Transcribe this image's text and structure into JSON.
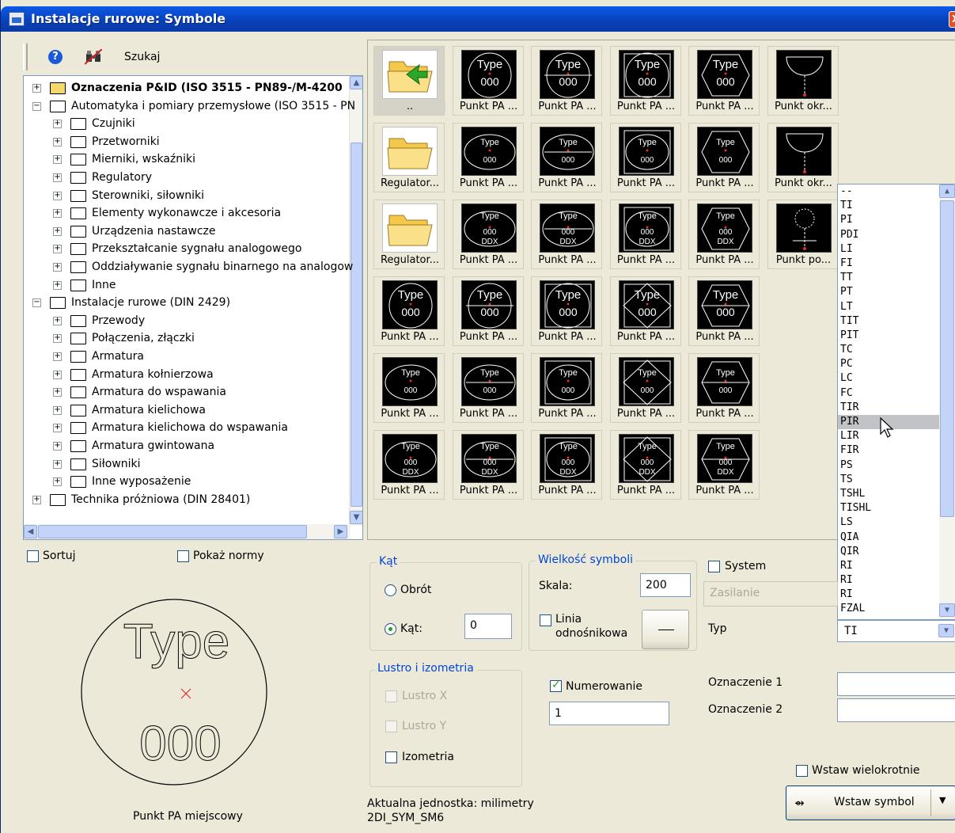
{
  "window": {
    "title": "Instalacje rurowe: Symbole",
    "close": "X"
  },
  "toolbar": {
    "search_label": "Szukaj"
  },
  "tree": {
    "items": [
      {
        "label": "Oznaczenia P&ID (ISO 3515 - PN89-/M-4200",
        "level": 0,
        "expanded": false,
        "bold": true,
        "open": true
      },
      {
        "label": "Automatyka i pomiary przemysłowe (ISO 3515 - PN",
        "level": 0,
        "expanded": true
      },
      {
        "label": "Czujniki",
        "level": 1
      },
      {
        "label": "Przetworniki",
        "level": 1
      },
      {
        "label": "Mierniki, wskaźniki",
        "level": 1
      },
      {
        "label": "Regulatory",
        "level": 1
      },
      {
        "label": "Sterowniki, siłowniki",
        "level": 1
      },
      {
        "label": "Elementy wykonawcze i akcesoria",
        "level": 1
      },
      {
        "label": "Urządzenia nastawcze",
        "level": 1
      },
      {
        "label": "Przekształcanie sygnału analogowego",
        "level": 1
      },
      {
        "label": "Oddziaływanie sygnału binarnego na analogow",
        "level": 1
      },
      {
        "label": "Inne",
        "level": 1
      },
      {
        "label": "Instalacje rurowe (DIN 2429)",
        "level": 0,
        "expanded": true
      },
      {
        "label": "Przewody",
        "level": 1
      },
      {
        "label": "Połączenia, złączki",
        "level": 1
      },
      {
        "label": "Armatura",
        "level": 1
      },
      {
        "label": "Armatura kołnierzowa",
        "level": 1
      },
      {
        "label": "Armatura do wspawania",
        "level": 1
      },
      {
        "label": "Armatura kielichowa",
        "level": 1
      },
      {
        "label": "Armatura kielichowa do wspawania",
        "level": 1
      },
      {
        "label": "Armatura gwintowana",
        "level": 1
      },
      {
        "label": "Siłowniki",
        "level": 1
      },
      {
        "label": "Inne wyposażenie",
        "level": 1
      },
      {
        "label": "Technika próżniowa (DIN 28401)",
        "level": 0,
        "expanded": false
      }
    ]
  },
  "symbols": {
    "rows": [
      [
        "..",
        "Punkt PA ...",
        "Punkt PA ...",
        "Punkt PA ...",
        "Punkt PA ...",
        "Punkt okr..."
      ],
      [
        "Regulator...",
        "Punkt PA ...",
        "Punkt PA ...",
        "Punkt PA ...",
        "Punkt PA ...",
        "Punkt okr..."
      ],
      [
        "Regulator...",
        "Punkt PA ...",
        "Punkt PA ...",
        "Punkt PA ...",
        "Punkt PA ...",
        "Punkt po..."
      ],
      [
        "Punkt PA ...",
        "Punkt PA ...",
        "Punkt PA ...",
        "Punkt PA ...",
        "Punkt PA ..."
      ],
      [
        "Punkt PA ...",
        "Punkt PA ...",
        "Punkt PA ...",
        "Punkt PA ...",
        "Punkt PA ..."
      ],
      [
        "Punkt PA ...",
        "Punkt PA ...",
        "Punkt PA ...",
        "Punkt PA ...",
        "Punkt PA ..."
      ]
    ],
    "glyph_type": "Type",
    "glyph_num": "000",
    "glyph_num2": "DDX"
  },
  "dropdown": {
    "items": [
      "--",
      "TI",
      "PI",
      "PDI",
      "LI",
      "FI",
      "TT",
      "PT",
      "LT",
      "TIT",
      "PIT",
      "TC",
      "PC",
      "LC",
      "FC",
      "TIR",
      "PIR",
      "LIR",
      "FIR",
      "PS",
      "TS",
      "TSHL",
      "TISHL",
      "LS",
      "QIA",
      "QIR",
      "RI",
      "RI",
      "RI",
      "FZAL"
    ],
    "highlighted": "PIR",
    "selected": "TI"
  },
  "options": {
    "sort": "Sortuj",
    "show_norms": "Pokaż normy"
  },
  "preview": {
    "type": "Type",
    "num": "000",
    "caption": "Punkt PA miejscowy"
  },
  "angle": {
    "title": "Kąt",
    "rotation": "Obrót",
    "angle": "Kąt:",
    "angle_value": "0"
  },
  "size": {
    "title": "Wielkość symboli",
    "scale": "Skala:",
    "scale_value": "200",
    "leader": "Linia",
    "leader2": "odnośnikowa"
  },
  "mirror": {
    "title": "Lustro i izometria",
    "mirror_x": "Lustro X",
    "mirror_y": "Lustro Y",
    "iso": "Izometria"
  },
  "system": {
    "label": "System",
    "placeholder": "Zasilanie",
    "type": "Typ"
  },
  "numbering": {
    "label": "Numerowanie",
    "value": "1"
  },
  "labels": {
    "l1": "Oznaczenie 1",
    "l2": "Oznaczenie 2"
  },
  "footer": {
    "unit": "Aktualna jednostka: milimetry",
    "code": "2DI_SYM_SM6"
  },
  "insert": {
    "multi": "Wstaw wielokrotnie",
    "button": "Wstaw symbol"
  }
}
